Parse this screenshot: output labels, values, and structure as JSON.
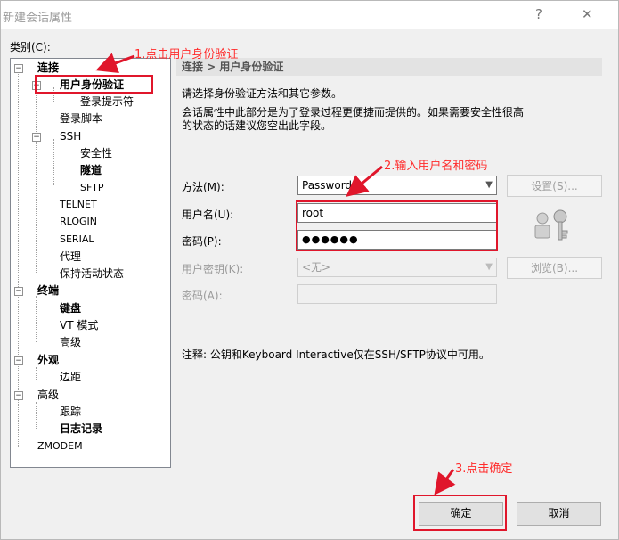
{
  "window": {
    "title": "新建会话属性",
    "help": "?",
    "close": "✕"
  },
  "category_label": "类别(C):",
  "tree": {
    "connect": "连接",
    "auth": "用户身份验证",
    "login_prompt": "登录提示符",
    "login_script": "登录脚本",
    "ssh": "SSH",
    "security": "安全性",
    "tunnel": "隧道",
    "sftp": "SFTP",
    "telnet": "TELNET",
    "rlogin": "RLOGIN",
    "serial": "SERIAL",
    "proxy": "代理",
    "keepalive": "保持活动状态",
    "terminal": "终端",
    "keyboard": "键盘",
    "vt_mode": "VT 模式",
    "advanced_term": "高级",
    "appearance": "外观",
    "margin": "边距",
    "advanced": "高级",
    "trace": "跟踪",
    "log": "日志记录",
    "zmodem": "ZMODEM"
  },
  "panel": {
    "header": "连接 > 用户身份验证",
    "desc1": "请选择身份验证方法和其它参数。",
    "desc2": "会话属性中此部分是为了登录过程更便捷而提供的。如果需要安全性很高",
    "desc3": "的状态的话建议您空出此字段。",
    "method_label": "方法(M):",
    "method_value": "Password",
    "settings_button": "设置(S)...",
    "username_label": "用户名(U):",
    "username_value": "root",
    "password_label": "密码(P):",
    "password_value": "●●●●●●",
    "user_key_label": "用户密钥(K):",
    "user_key_value": "<无>",
    "browse_button": "浏览(B)...",
    "passphrase_label": "密码(A):",
    "note": "注释: 公钥和Keyboard Interactive仅在SSH/SFTP协议中可用。"
  },
  "buttons": {
    "ok": "确定",
    "cancel": "取消"
  },
  "annotations": {
    "step1": "1.点击用户身份验证",
    "step2": "2.输入用户名和密码",
    "step3": "3.点击确定"
  },
  "colors": {
    "annotation": "#e0162b"
  }
}
